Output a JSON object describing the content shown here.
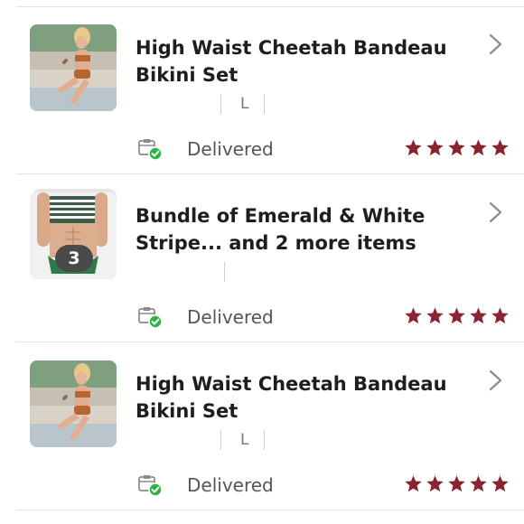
{
  "orders": [
    {
      "title_line1": "High Waist Cheetah Bandeau",
      "title_line2": "Bikini Set",
      "size": "L",
      "status": "Delivered",
      "rating": 5,
      "thumbnail": "cheetah-bikini-photo",
      "badge": null
    },
    {
      "title_line1": "Bundle of Emerald & White",
      "title_line2": "Stripe... and 2 more items",
      "size": "",
      "status": "Delivered",
      "rating": 5,
      "thumbnail": "striped-bikini-photo",
      "badge": "3"
    },
    {
      "title_line1": "High Waist Cheetah Bandeau",
      "title_line2": "Bikini Set",
      "size": "L",
      "status": "Delivered",
      "rating": 5,
      "thumbnail": "cheetah-bikini-photo",
      "badge": null
    }
  ],
  "icons": {
    "status": "delivered-package-icon",
    "chevron": "chevron-right-icon",
    "star": "star-icon"
  },
  "colors": {
    "star": "#8b2331",
    "check": "#2fb344",
    "divider": "#e4e4e4"
  }
}
